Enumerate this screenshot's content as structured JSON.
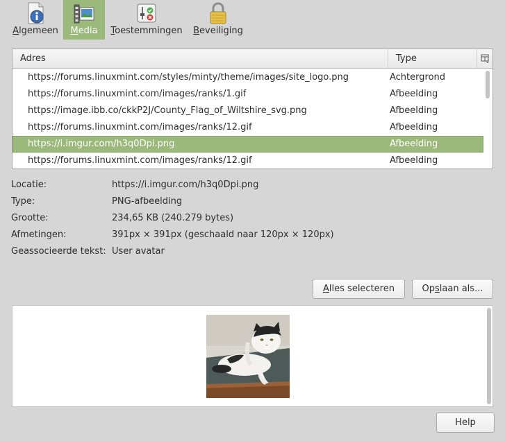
{
  "tabs": [
    {
      "label_pre": "",
      "mnemonic": "A",
      "label_post": "lgemeen",
      "icon": "info-icon",
      "active": false
    },
    {
      "label_pre": "",
      "mnemonic": "M",
      "label_post": "edia",
      "icon": "media-icon",
      "active": true
    },
    {
      "label_pre": "",
      "mnemonic": "T",
      "label_post": "oestemmingen",
      "icon": "permissions-icon",
      "active": false
    },
    {
      "label_pre": "",
      "mnemonic": "B",
      "label_post": "eveiliging",
      "icon": "lock-icon",
      "active": false
    }
  ],
  "media_list": {
    "columns": {
      "adres": "Adres",
      "type": "Type"
    },
    "column_picker_icon": "column-picker-icon",
    "rows": [
      {
        "adres": "https://forums.linuxmint.com/styles/minty/theme/images/site_logo.png",
        "type": "Achtergrond",
        "selected": false
      },
      {
        "adres": "https://forums.linuxmint.com/images/ranks/1.gif",
        "type": "Afbeelding",
        "selected": false
      },
      {
        "adres": "https://image.ibb.co/ckkP2J/County_Flag_of_Wiltshire_svg.png",
        "type": "Afbeelding",
        "selected": false
      },
      {
        "adres": "https://forums.linuxmint.com/images/ranks/12.gif",
        "type": "Afbeelding",
        "selected": false
      },
      {
        "adres": "https://i.imgur.com/h3q0Dpi.png",
        "type": "Afbeelding",
        "selected": true
      },
      {
        "adres": "https://forums.linuxmint.com/images/ranks/12.gif",
        "type": "Afbeelding",
        "selected": false
      }
    ]
  },
  "properties": {
    "locatie": {
      "label": "Locatie:",
      "value": "https://i.imgur.com/h3q0Dpi.png"
    },
    "type": {
      "label": "Type:",
      "value": "PNG-afbeelding"
    },
    "grootte": {
      "label": "Grootte:",
      "value": "234,65 KB (240.279 bytes)"
    },
    "afmetingen": {
      "label": "Afmetingen:",
      "value": "391px × 391px (geschaald naar 120px × 120px)"
    },
    "tekst": {
      "label": "Geassocieerde tekst:",
      "value": "User avatar"
    }
  },
  "buttons": {
    "select_all": {
      "pre": "",
      "mnemonic": "A",
      "post": "lles selecteren"
    },
    "save_as": {
      "pre": "Op",
      "mnemonic": "s",
      "post": "laan als..."
    },
    "help": {
      "label": "Help"
    }
  },
  "colors": {
    "accent": "#9cb97c",
    "window_bg": "#d6d6d6"
  }
}
